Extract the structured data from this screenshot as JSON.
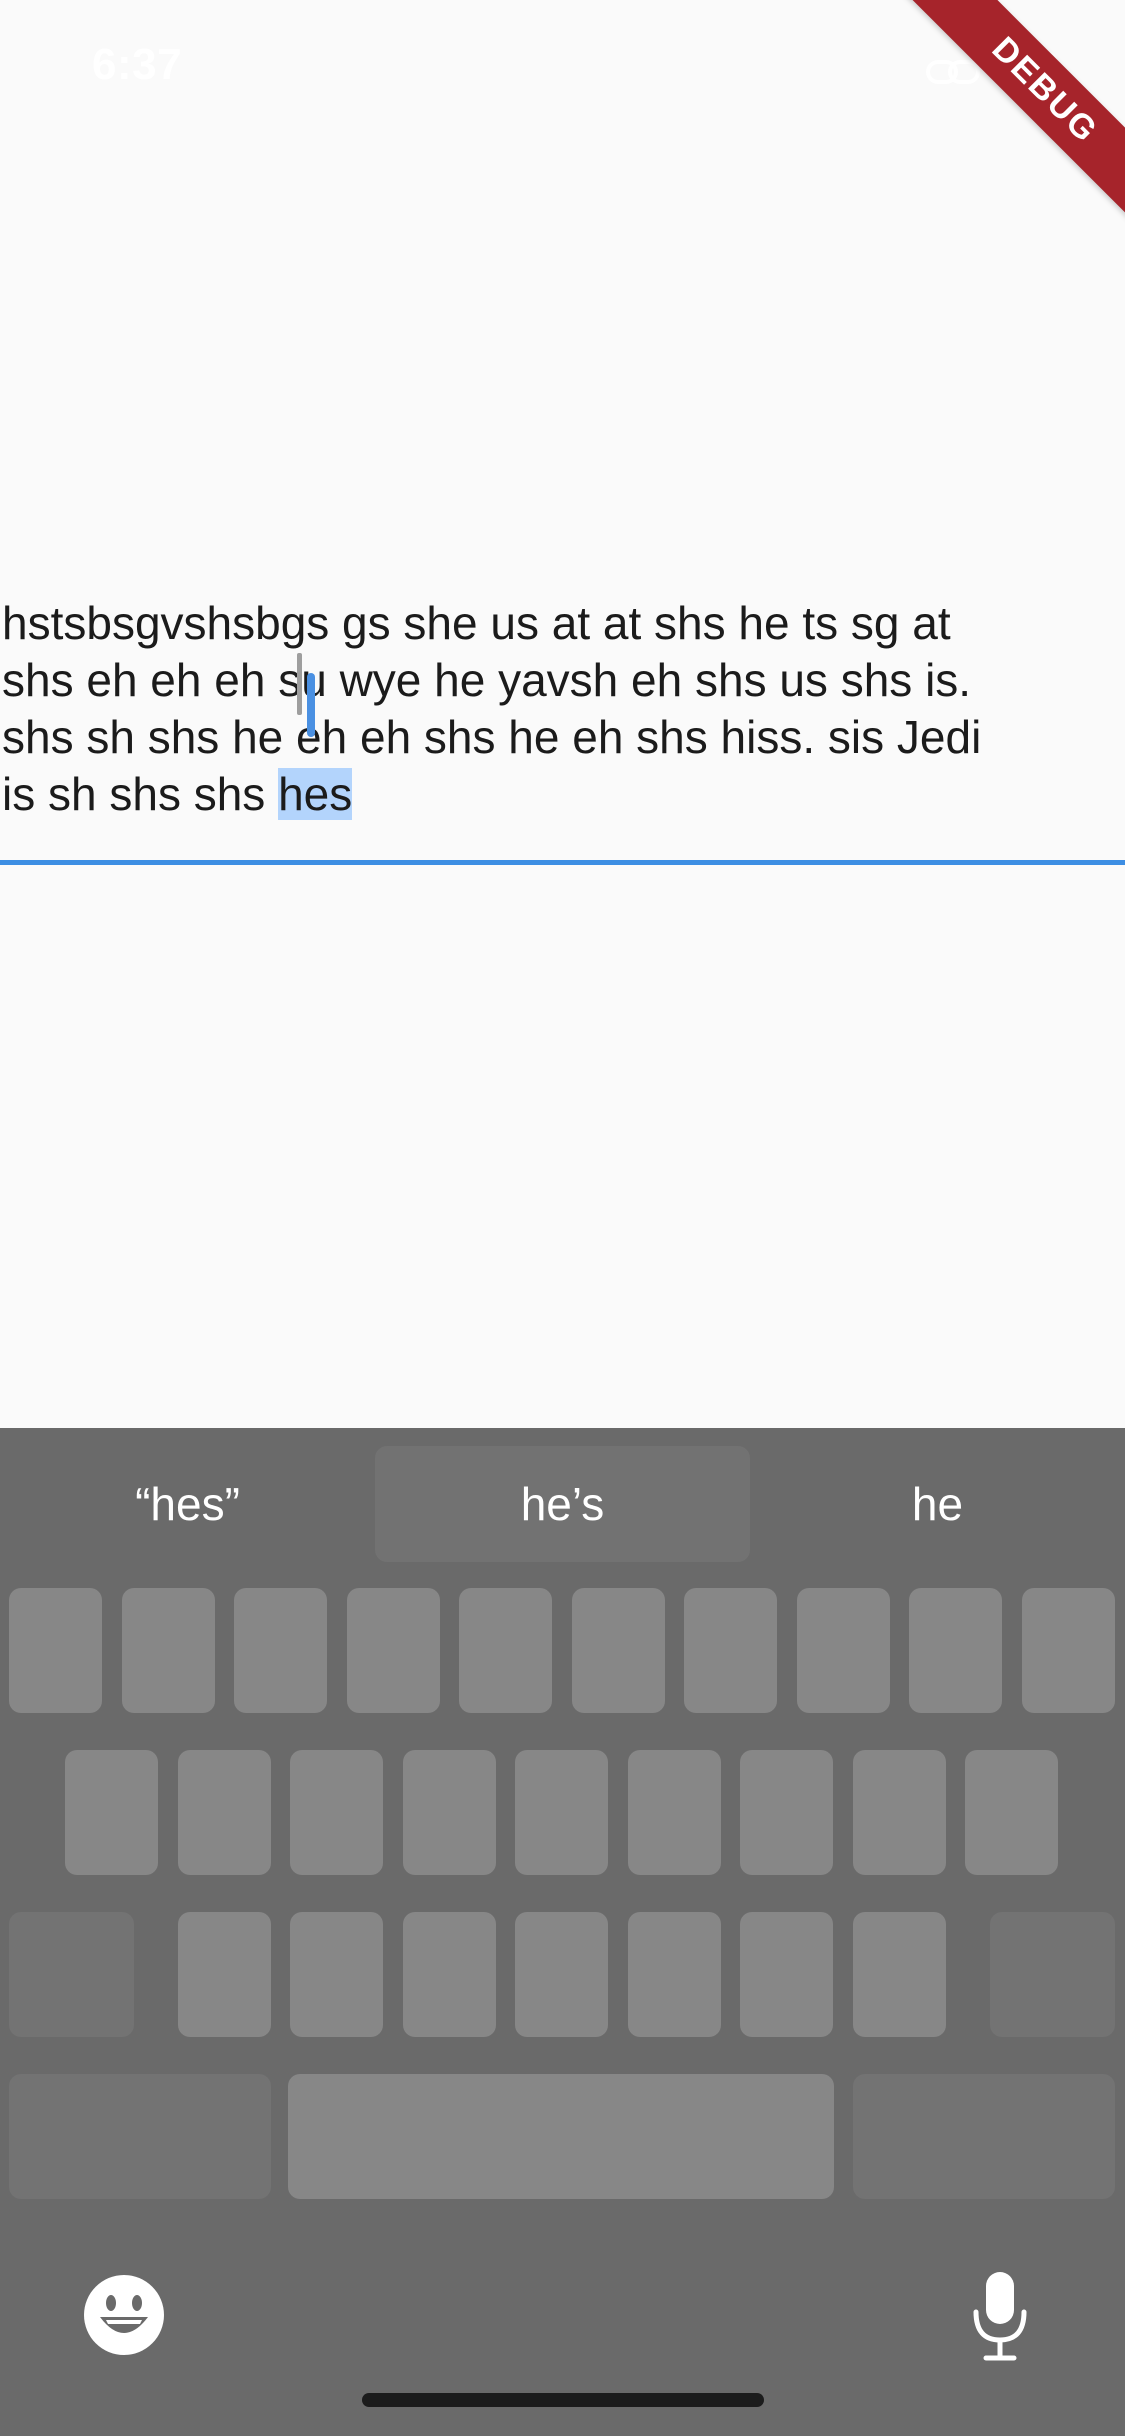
{
  "status_bar": {
    "time": "6:37",
    "battery_color": "#4cd964"
  },
  "debug_banner": {
    "label": "DEBUG"
  },
  "text_field": {
    "lines": [
      "hstsbsgvshsbgs gs she us at at shs he ts sg at",
      "shs eh eh eh su wye he yavsh eh shs us shs is.",
      "shs sh shs he eh eh shs he eh shs hiss. sis Jedi",
      "is sh shs shs "
    ],
    "selected_word": "hes",
    "underline_color": "#3d8ee3",
    "selection_color": "#b3d4fc"
  },
  "keyboard": {
    "suggestions": [
      "“hes”",
      "he’s",
      "he"
    ],
    "icons": {
      "emoji": "emoji-icon",
      "mic": "microphone-icon"
    },
    "background": "#6a6a6a"
  }
}
